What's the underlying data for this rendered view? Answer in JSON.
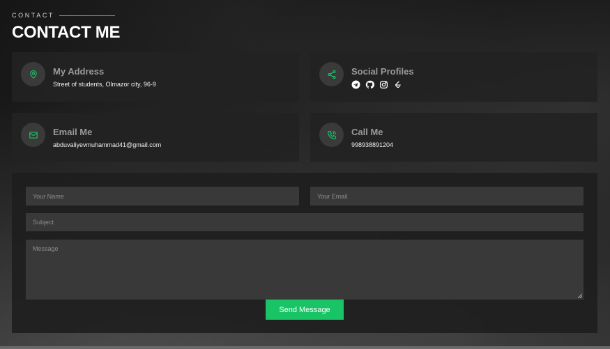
{
  "section": {
    "label": "CONTACT",
    "title": "CONTACT ME"
  },
  "accent_color": "#18c466",
  "cards": {
    "address": {
      "title": "My Address",
      "value": "Street of students, Olmazor city, 96-9",
      "icon": "map-pin-icon"
    },
    "social": {
      "title": "Social Profiles",
      "icon": "share-icon",
      "links": [
        "telegram-icon",
        "github-icon",
        "instagram-icon",
        "leetcode-icon"
      ]
    },
    "email": {
      "title": "Email Me",
      "value": "abduvaliyevmuhammad41@gmail.com",
      "icon": "mail-icon"
    },
    "phone": {
      "title": "Call Me",
      "value": "998938891204",
      "icon": "phone-icon"
    }
  },
  "form": {
    "name_placeholder": "Your Name",
    "email_placeholder": "Your Email",
    "subject_placeholder": "Subject",
    "message_placeholder": "Message",
    "submit_label": "Send Message"
  }
}
